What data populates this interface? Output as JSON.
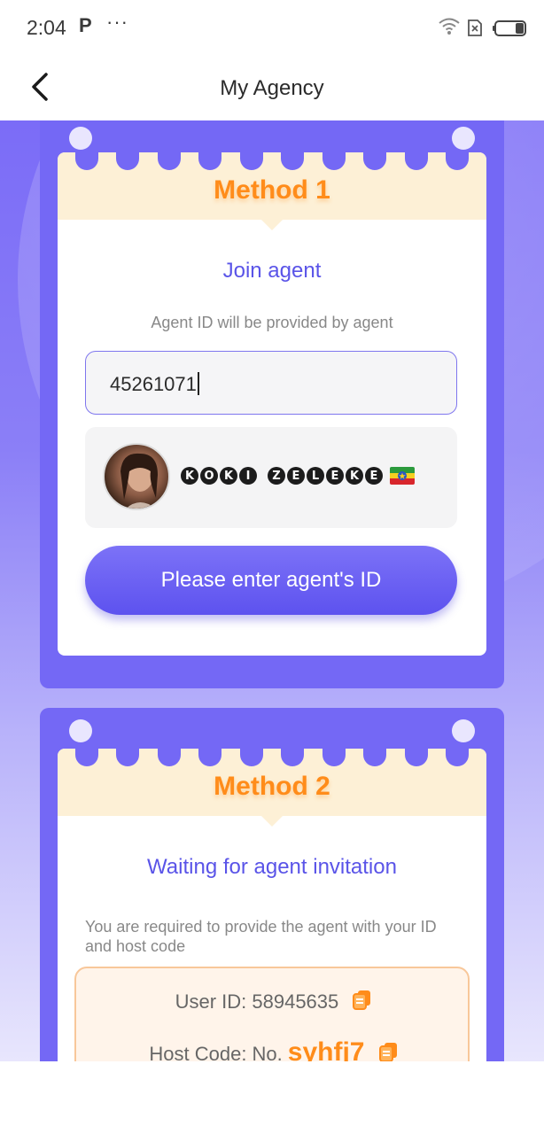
{
  "status_bar": {
    "time": "2:04",
    "carrier_glyph": "P",
    "more": "···"
  },
  "header": {
    "title": "My Agency",
    "back_icon": "chevron-left-icon"
  },
  "method1": {
    "badge": "Method 1",
    "heading": "Join agent",
    "hint": "Agent ID will be provided by agent",
    "input_value": "45261071",
    "agent": {
      "name_letters": [
        "K",
        "O",
        "K",
        "I",
        " ",
        "Z",
        "E",
        "L",
        "E",
        "K",
        "E"
      ],
      "flag": "Ethiopia flag"
    },
    "button_label": "Please enter agent's ID"
  },
  "method2": {
    "badge": "Method 2",
    "heading": "Waiting for agent invitation",
    "description": "You are required to provide the agent with your ID and host code",
    "user_id_label": "User ID: 58945635",
    "host_code_label": "Host Code: No.",
    "host_code_value": "syhfj7"
  },
  "colors": {
    "accent": "#5a54e8",
    "card": "#7468f5",
    "orange": "#ff8c1a",
    "band": "#fdf0d6"
  }
}
